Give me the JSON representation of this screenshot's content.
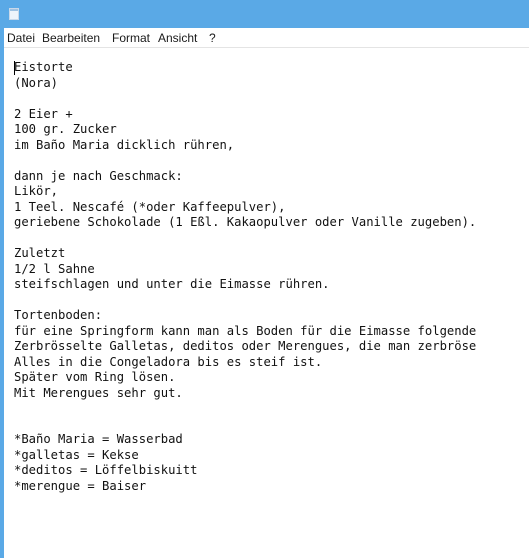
{
  "menu": {
    "items": [
      {
        "label": "Datei"
      },
      {
        "label": "Bearbeiten"
      },
      {
        "label": "Format"
      },
      {
        "label": "Ansicht"
      },
      {
        "label": "?"
      }
    ]
  },
  "document": {
    "lines": [
      "Eistorte",
      "(Nora)",
      "",
      "2 Eier +",
      "100 gr. Zucker",
      "im Baño Maria dicklich rühren,",
      "",
      "dann je nach Geschmack:",
      "Likör,",
      "1 Teel. Nescafé (*oder Kaffeepulver),",
      "geriebene Schokolade (1 Eßl. Kakaopulver oder Vanille zugeben).",
      "",
      "Zuletzt",
      "1/2 l Sahne",
      "steifschlagen und unter die Eimasse rühren.",
      "",
      "Tortenboden:",
      "für eine Springform kann man als Boden für die Eimasse folgende",
      "Zerbrösselte Galletas, deditos oder Merengues, die man zerbröse",
      "Alles in die Congeladora bis es steif ist.",
      "Später vom Ring lösen.",
      "Mit Merengues sehr gut.",
      "",
      "",
      "*Baño Maria = Wasserbad",
      "*galletas = Kekse",
      "*deditos = Löffelbiskuitt",
      "*merengue = Baiser"
    ]
  },
  "colors": {
    "titlebar": "#5aa9e6",
    "background": "#ffffff",
    "text": "#111111"
  },
  "icons": {
    "app": "notepad-icon"
  }
}
